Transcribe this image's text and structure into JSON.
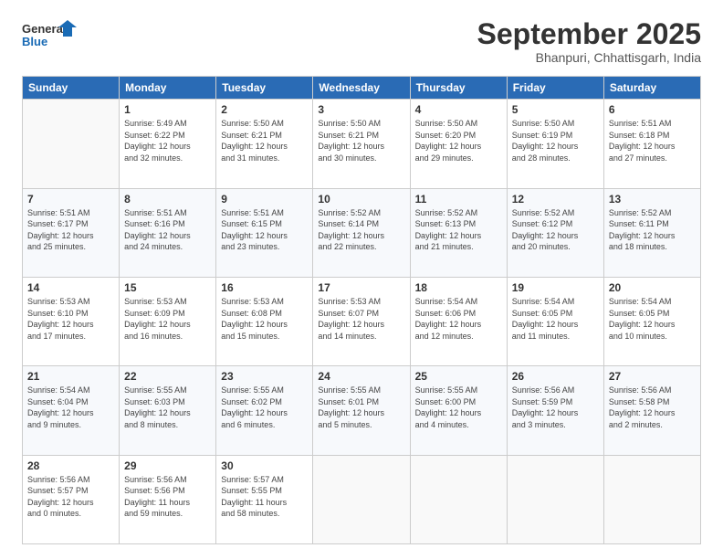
{
  "logo": {
    "line1": "General",
    "line2": "Blue"
  },
  "title": "September 2025",
  "subtitle": "Bhanpuri, Chhattisgarh, India",
  "weekdays": [
    "Sunday",
    "Monday",
    "Tuesday",
    "Wednesday",
    "Thursday",
    "Friday",
    "Saturday"
  ],
  "weeks": [
    [
      {
        "day": "",
        "info": ""
      },
      {
        "day": "1",
        "info": "Sunrise: 5:49 AM\nSunset: 6:22 PM\nDaylight: 12 hours\nand 32 minutes."
      },
      {
        "day": "2",
        "info": "Sunrise: 5:50 AM\nSunset: 6:21 PM\nDaylight: 12 hours\nand 31 minutes."
      },
      {
        "day": "3",
        "info": "Sunrise: 5:50 AM\nSunset: 6:21 PM\nDaylight: 12 hours\nand 30 minutes."
      },
      {
        "day": "4",
        "info": "Sunrise: 5:50 AM\nSunset: 6:20 PM\nDaylight: 12 hours\nand 29 minutes."
      },
      {
        "day": "5",
        "info": "Sunrise: 5:50 AM\nSunset: 6:19 PM\nDaylight: 12 hours\nand 28 minutes."
      },
      {
        "day": "6",
        "info": "Sunrise: 5:51 AM\nSunset: 6:18 PM\nDaylight: 12 hours\nand 27 minutes."
      }
    ],
    [
      {
        "day": "7",
        "info": "Sunrise: 5:51 AM\nSunset: 6:17 PM\nDaylight: 12 hours\nand 25 minutes."
      },
      {
        "day": "8",
        "info": "Sunrise: 5:51 AM\nSunset: 6:16 PM\nDaylight: 12 hours\nand 24 minutes."
      },
      {
        "day": "9",
        "info": "Sunrise: 5:51 AM\nSunset: 6:15 PM\nDaylight: 12 hours\nand 23 minutes."
      },
      {
        "day": "10",
        "info": "Sunrise: 5:52 AM\nSunset: 6:14 PM\nDaylight: 12 hours\nand 22 minutes."
      },
      {
        "day": "11",
        "info": "Sunrise: 5:52 AM\nSunset: 6:13 PM\nDaylight: 12 hours\nand 21 minutes."
      },
      {
        "day": "12",
        "info": "Sunrise: 5:52 AM\nSunset: 6:12 PM\nDaylight: 12 hours\nand 20 minutes."
      },
      {
        "day": "13",
        "info": "Sunrise: 5:52 AM\nSunset: 6:11 PM\nDaylight: 12 hours\nand 18 minutes."
      }
    ],
    [
      {
        "day": "14",
        "info": "Sunrise: 5:53 AM\nSunset: 6:10 PM\nDaylight: 12 hours\nand 17 minutes."
      },
      {
        "day": "15",
        "info": "Sunrise: 5:53 AM\nSunset: 6:09 PM\nDaylight: 12 hours\nand 16 minutes."
      },
      {
        "day": "16",
        "info": "Sunrise: 5:53 AM\nSunset: 6:08 PM\nDaylight: 12 hours\nand 15 minutes."
      },
      {
        "day": "17",
        "info": "Sunrise: 5:53 AM\nSunset: 6:07 PM\nDaylight: 12 hours\nand 14 minutes."
      },
      {
        "day": "18",
        "info": "Sunrise: 5:54 AM\nSunset: 6:06 PM\nDaylight: 12 hours\nand 12 minutes."
      },
      {
        "day": "19",
        "info": "Sunrise: 5:54 AM\nSunset: 6:05 PM\nDaylight: 12 hours\nand 11 minutes."
      },
      {
        "day": "20",
        "info": "Sunrise: 5:54 AM\nSunset: 6:05 PM\nDaylight: 12 hours\nand 10 minutes."
      }
    ],
    [
      {
        "day": "21",
        "info": "Sunrise: 5:54 AM\nSunset: 6:04 PM\nDaylight: 12 hours\nand 9 minutes."
      },
      {
        "day": "22",
        "info": "Sunrise: 5:55 AM\nSunset: 6:03 PM\nDaylight: 12 hours\nand 8 minutes."
      },
      {
        "day": "23",
        "info": "Sunrise: 5:55 AM\nSunset: 6:02 PM\nDaylight: 12 hours\nand 6 minutes."
      },
      {
        "day": "24",
        "info": "Sunrise: 5:55 AM\nSunset: 6:01 PM\nDaylight: 12 hours\nand 5 minutes."
      },
      {
        "day": "25",
        "info": "Sunrise: 5:55 AM\nSunset: 6:00 PM\nDaylight: 12 hours\nand 4 minutes."
      },
      {
        "day": "26",
        "info": "Sunrise: 5:56 AM\nSunset: 5:59 PM\nDaylight: 12 hours\nand 3 minutes."
      },
      {
        "day": "27",
        "info": "Sunrise: 5:56 AM\nSunset: 5:58 PM\nDaylight: 12 hours\nand 2 minutes."
      }
    ],
    [
      {
        "day": "28",
        "info": "Sunrise: 5:56 AM\nSunset: 5:57 PM\nDaylight: 12 hours\nand 0 minutes."
      },
      {
        "day": "29",
        "info": "Sunrise: 5:56 AM\nSunset: 5:56 PM\nDaylight: 11 hours\nand 59 minutes."
      },
      {
        "day": "30",
        "info": "Sunrise: 5:57 AM\nSunset: 5:55 PM\nDaylight: 11 hours\nand 58 minutes."
      },
      {
        "day": "",
        "info": ""
      },
      {
        "day": "",
        "info": ""
      },
      {
        "day": "",
        "info": ""
      },
      {
        "day": "",
        "info": ""
      }
    ]
  ]
}
